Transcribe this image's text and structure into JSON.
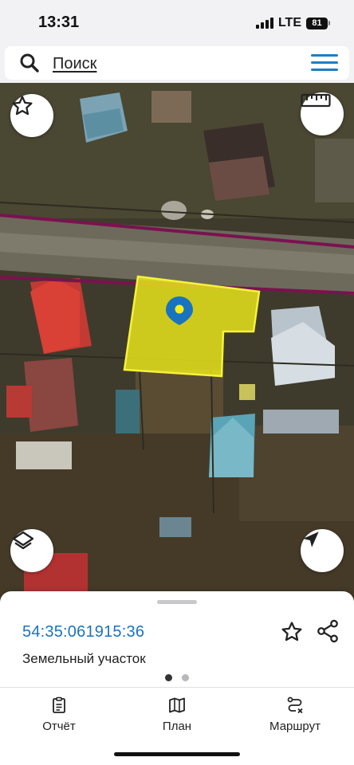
{
  "status_bar": {
    "time": "13:31",
    "network": "LTE",
    "battery": "81"
  },
  "search": {
    "label": "Поиск"
  },
  "map": {
    "buttons": {
      "favorite_icon": "star-icon",
      "ruler_icon": "ruler-icon",
      "layers_icon": "layers-icon",
      "locate_icon": "navigation-arrow-icon"
    },
    "parcel_color": "#f2ef1a",
    "boundary_color": "#7a1250",
    "marker_color": "#1a73c0"
  },
  "sheet": {
    "cadastral_number": "54:35:061915:36",
    "parcel_type": "Земельный участок",
    "page_count": 2,
    "current_page": 1
  },
  "tabs": [
    {
      "label": "Отчёт",
      "icon": "clipboard-icon"
    },
    {
      "label": "План",
      "icon": "map-icon"
    },
    {
      "label": "Маршрут",
      "icon": "route-icon"
    }
  ],
  "colors": {
    "accent": "#1a73c0",
    "menu": "#1d7fc4"
  }
}
